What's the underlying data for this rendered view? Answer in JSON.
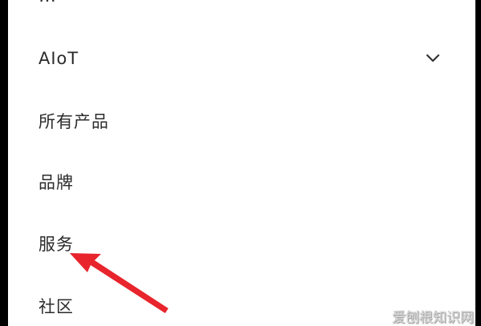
{
  "menu": {
    "top_partial": "…",
    "items": [
      {
        "label": "AIoT",
        "icon": "chevron-down-icon",
        "expanded": false
      },
      {
        "label": "所有产品"
      },
      {
        "label": "品牌"
      },
      {
        "label": "服务"
      },
      {
        "label": "社区"
      }
    ]
  },
  "annotation": {
    "arrow_color": "#e8242c",
    "target": "服务"
  },
  "watermark": "爱刨根知识网",
  "colors": {
    "frame": "#000000",
    "background": "#ffffff",
    "text": "#2b2b2b"
  }
}
